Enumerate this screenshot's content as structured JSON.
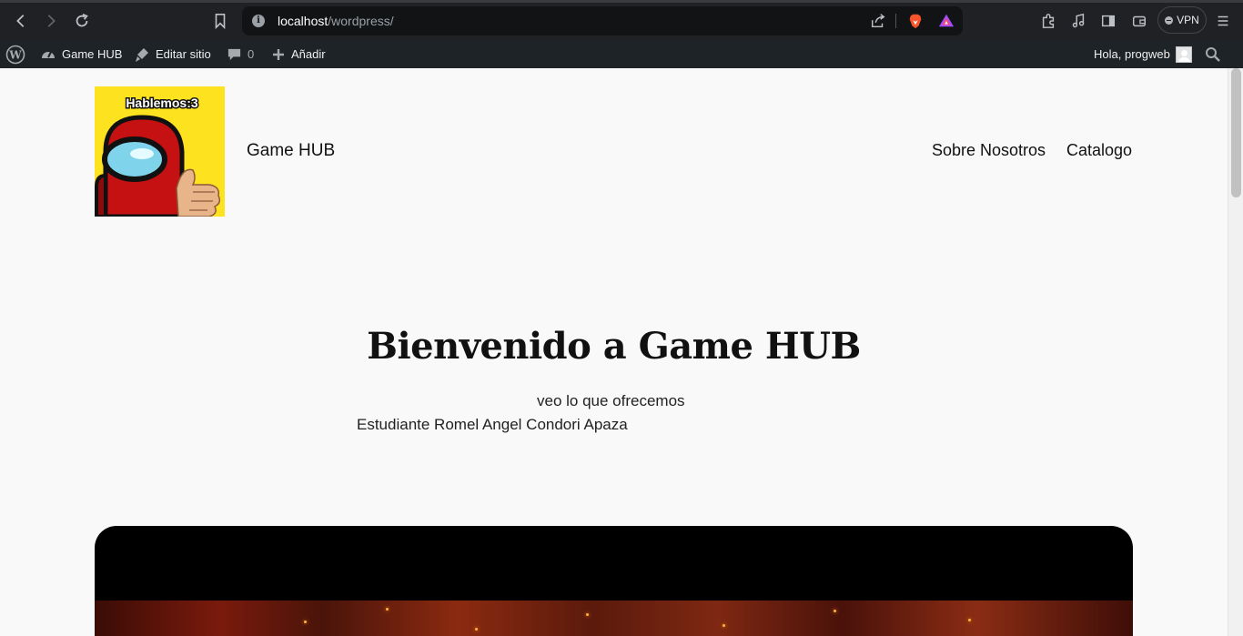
{
  "browser": {
    "url_host": "localhost",
    "url_path": "/wordpress/",
    "vpn_label": "VPN"
  },
  "admin_bar": {
    "site_name": "Game HUB",
    "edit_site": "Editar sitio",
    "comments_count": "0",
    "add_new": "Añadir",
    "greeting": "Hola, progweb"
  },
  "logo": {
    "caption": "Hablemos:3",
    "colors": {
      "background": "#fde21f",
      "body": "#c51111",
      "visor": "#7fd3ea"
    }
  },
  "header": {
    "site_title": "Game HUB",
    "nav": [
      "Sobre Nosotros",
      "Catalogo"
    ]
  },
  "hero": {
    "title": "Bienvenido a Game HUB",
    "subtitle": "veo lo que ofrecemos",
    "author": "Estudiante Romel Angel Condori Apaza"
  }
}
